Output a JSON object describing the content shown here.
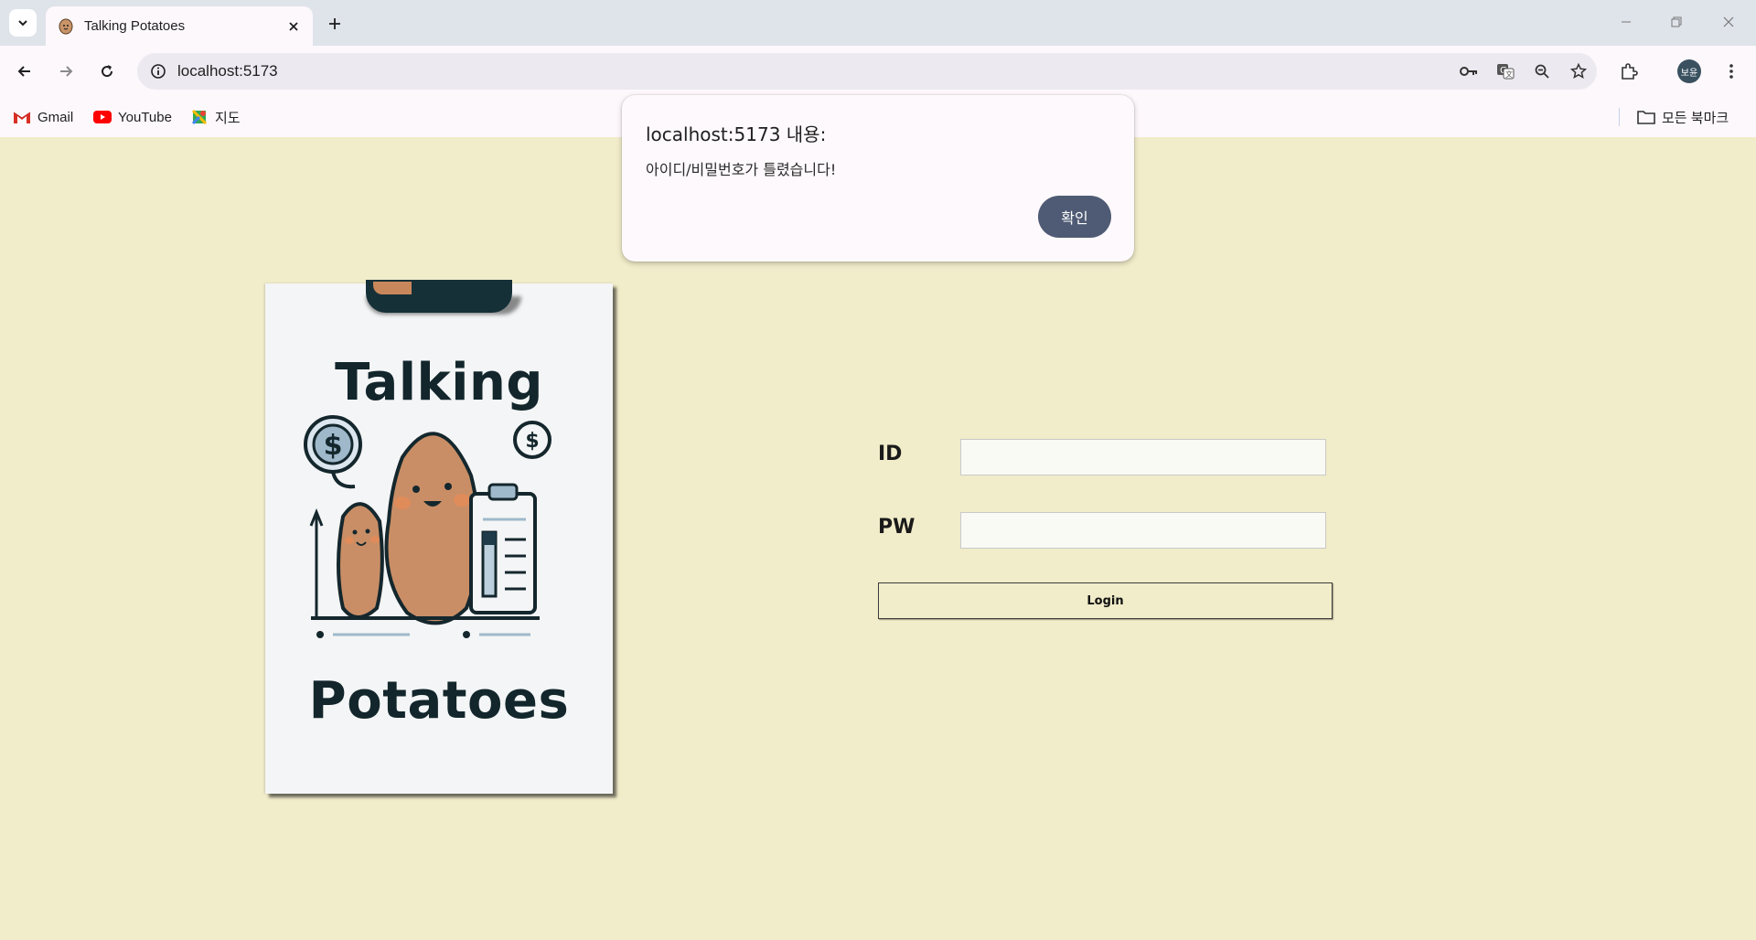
{
  "browser": {
    "tab": {
      "title": "Talking Potatoes",
      "favicon": "potato-icon"
    },
    "address": {
      "url": "localhost:5173"
    },
    "profile_initials": "보윤",
    "bookmarks": [
      {
        "label": "Gmail",
        "icon": "gmail-icon"
      },
      {
        "label": "YouTube",
        "icon": "youtube-icon"
      },
      {
        "label": "지도",
        "icon": "maps-icon"
      }
    ],
    "all_bookmarks_label": "모든 북마크"
  },
  "dialog": {
    "title": "localhost:5173 내용:",
    "message": "아이디/비밀번호가 틀렸습니다!",
    "ok_label": "확인"
  },
  "logo_card": {
    "title_top": "Talking",
    "title_bottom": "Potatoes"
  },
  "login_form": {
    "id_label": "ID",
    "id_value": "",
    "pw_label": "PW",
    "pw_value": "",
    "login_label": "Login"
  },
  "colors": {
    "page_background": "#f1ecc9",
    "dialog_button": "#4f5b74",
    "chrome_background": "#dfe3ea"
  }
}
